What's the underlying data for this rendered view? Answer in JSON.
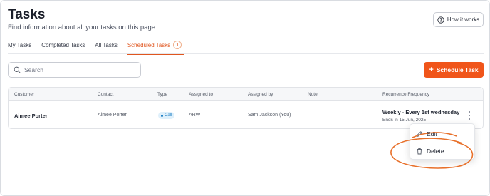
{
  "header": {
    "title": "Tasks",
    "subtitle": "Find information about all your tasks on this page.",
    "how_it_works_label": "How it works"
  },
  "tabs": [
    {
      "label": "My Tasks",
      "active": false
    },
    {
      "label": "Completed Tasks",
      "active": false
    },
    {
      "label": "All Tasks",
      "active": false
    },
    {
      "label": "Scheduled Tasks",
      "active": true,
      "count": "1"
    }
  ],
  "search": {
    "placeholder": "Search",
    "value": ""
  },
  "schedule_button": {
    "label": "Schedule Task"
  },
  "table": {
    "columns": [
      "Customer",
      "Contact",
      "Type",
      "Assigned to",
      "Assigned by",
      "Note",
      "Recurrence Frequency"
    ],
    "rows": [
      {
        "customer": "Aimee Porter",
        "contact": "Aimee Porter",
        "type": "Call",
        "assigned_to": "ARW",
        "assigned_by": "Sam Jackson (You)",
        "note": "",
        "recurrence": "Weekly - Every 1st wednesday",
        "recurrence_end": "Ends in 15 Jun, 2025"
      }
    ]
  },
  "row_menu": {
    "edit_label": "Edit",
    "delete_label": "Delete"
  },
  "colors": {
    "accent": "#f0551a",
    "accent_text": "#e0561f",
    "annotation_circle": "#e8702a",
    "call_badge_bg": "#dff0fb",
    "call_badge_text": "#1d7fc4"
  },
  "icons": {
    "how_it_works": "question-circle-icon",
    "search": "search-icon",
    "schedule": "plus-icon",
    "row_actions": "kebab-menu-icon",
    "edit": "pencil-icon",
    "delete": "trash-icon"
  }
}
